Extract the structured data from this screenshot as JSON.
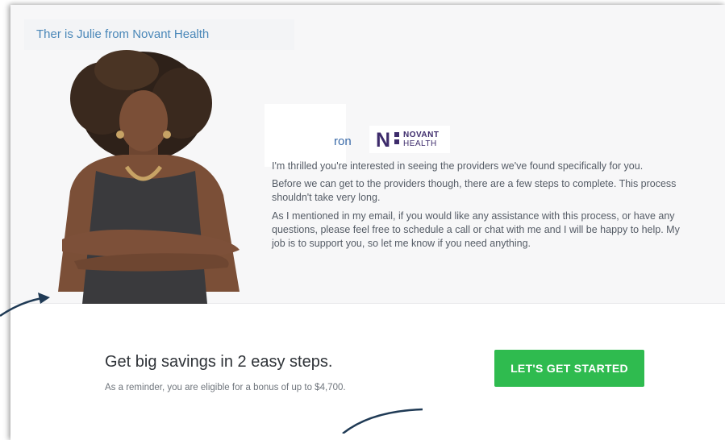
{
  "caption": "Ther is Julie from Novant Health",
  "intro_name_visible": "ron",
  "logo": {
    "line1": "NOVANT",
    "line2": "HEALTH"
  },
  "message": {
    "p1": "I'm thrilled you're interested in seeing the providers we've found specifically for you.",
    "p2": "Before we can get to the providers though, there are a few steps to complete. This process shouldn't take very long.",
    "p3": "As I mentioned in my email, if you would like any assistance with this process, or have any questions, please feel free to schedule a call or chat with me and I will be happy to help. My job is to support you, so let me know if you need anything."
  },
  "cta": {
    "title": "Get big savings in 2 easy steps.",
    "subtitle": "As a reminder, you are eligible for a bonus of up to $4,700.",
    "button_label": "LET'S GET STARTED"
  },
  "colors": {
    "accent_green": "#2fbb4f",
    "brand_purple": "#3d2b6b",
    "link_blue": "#4a87b8"
  }
}
